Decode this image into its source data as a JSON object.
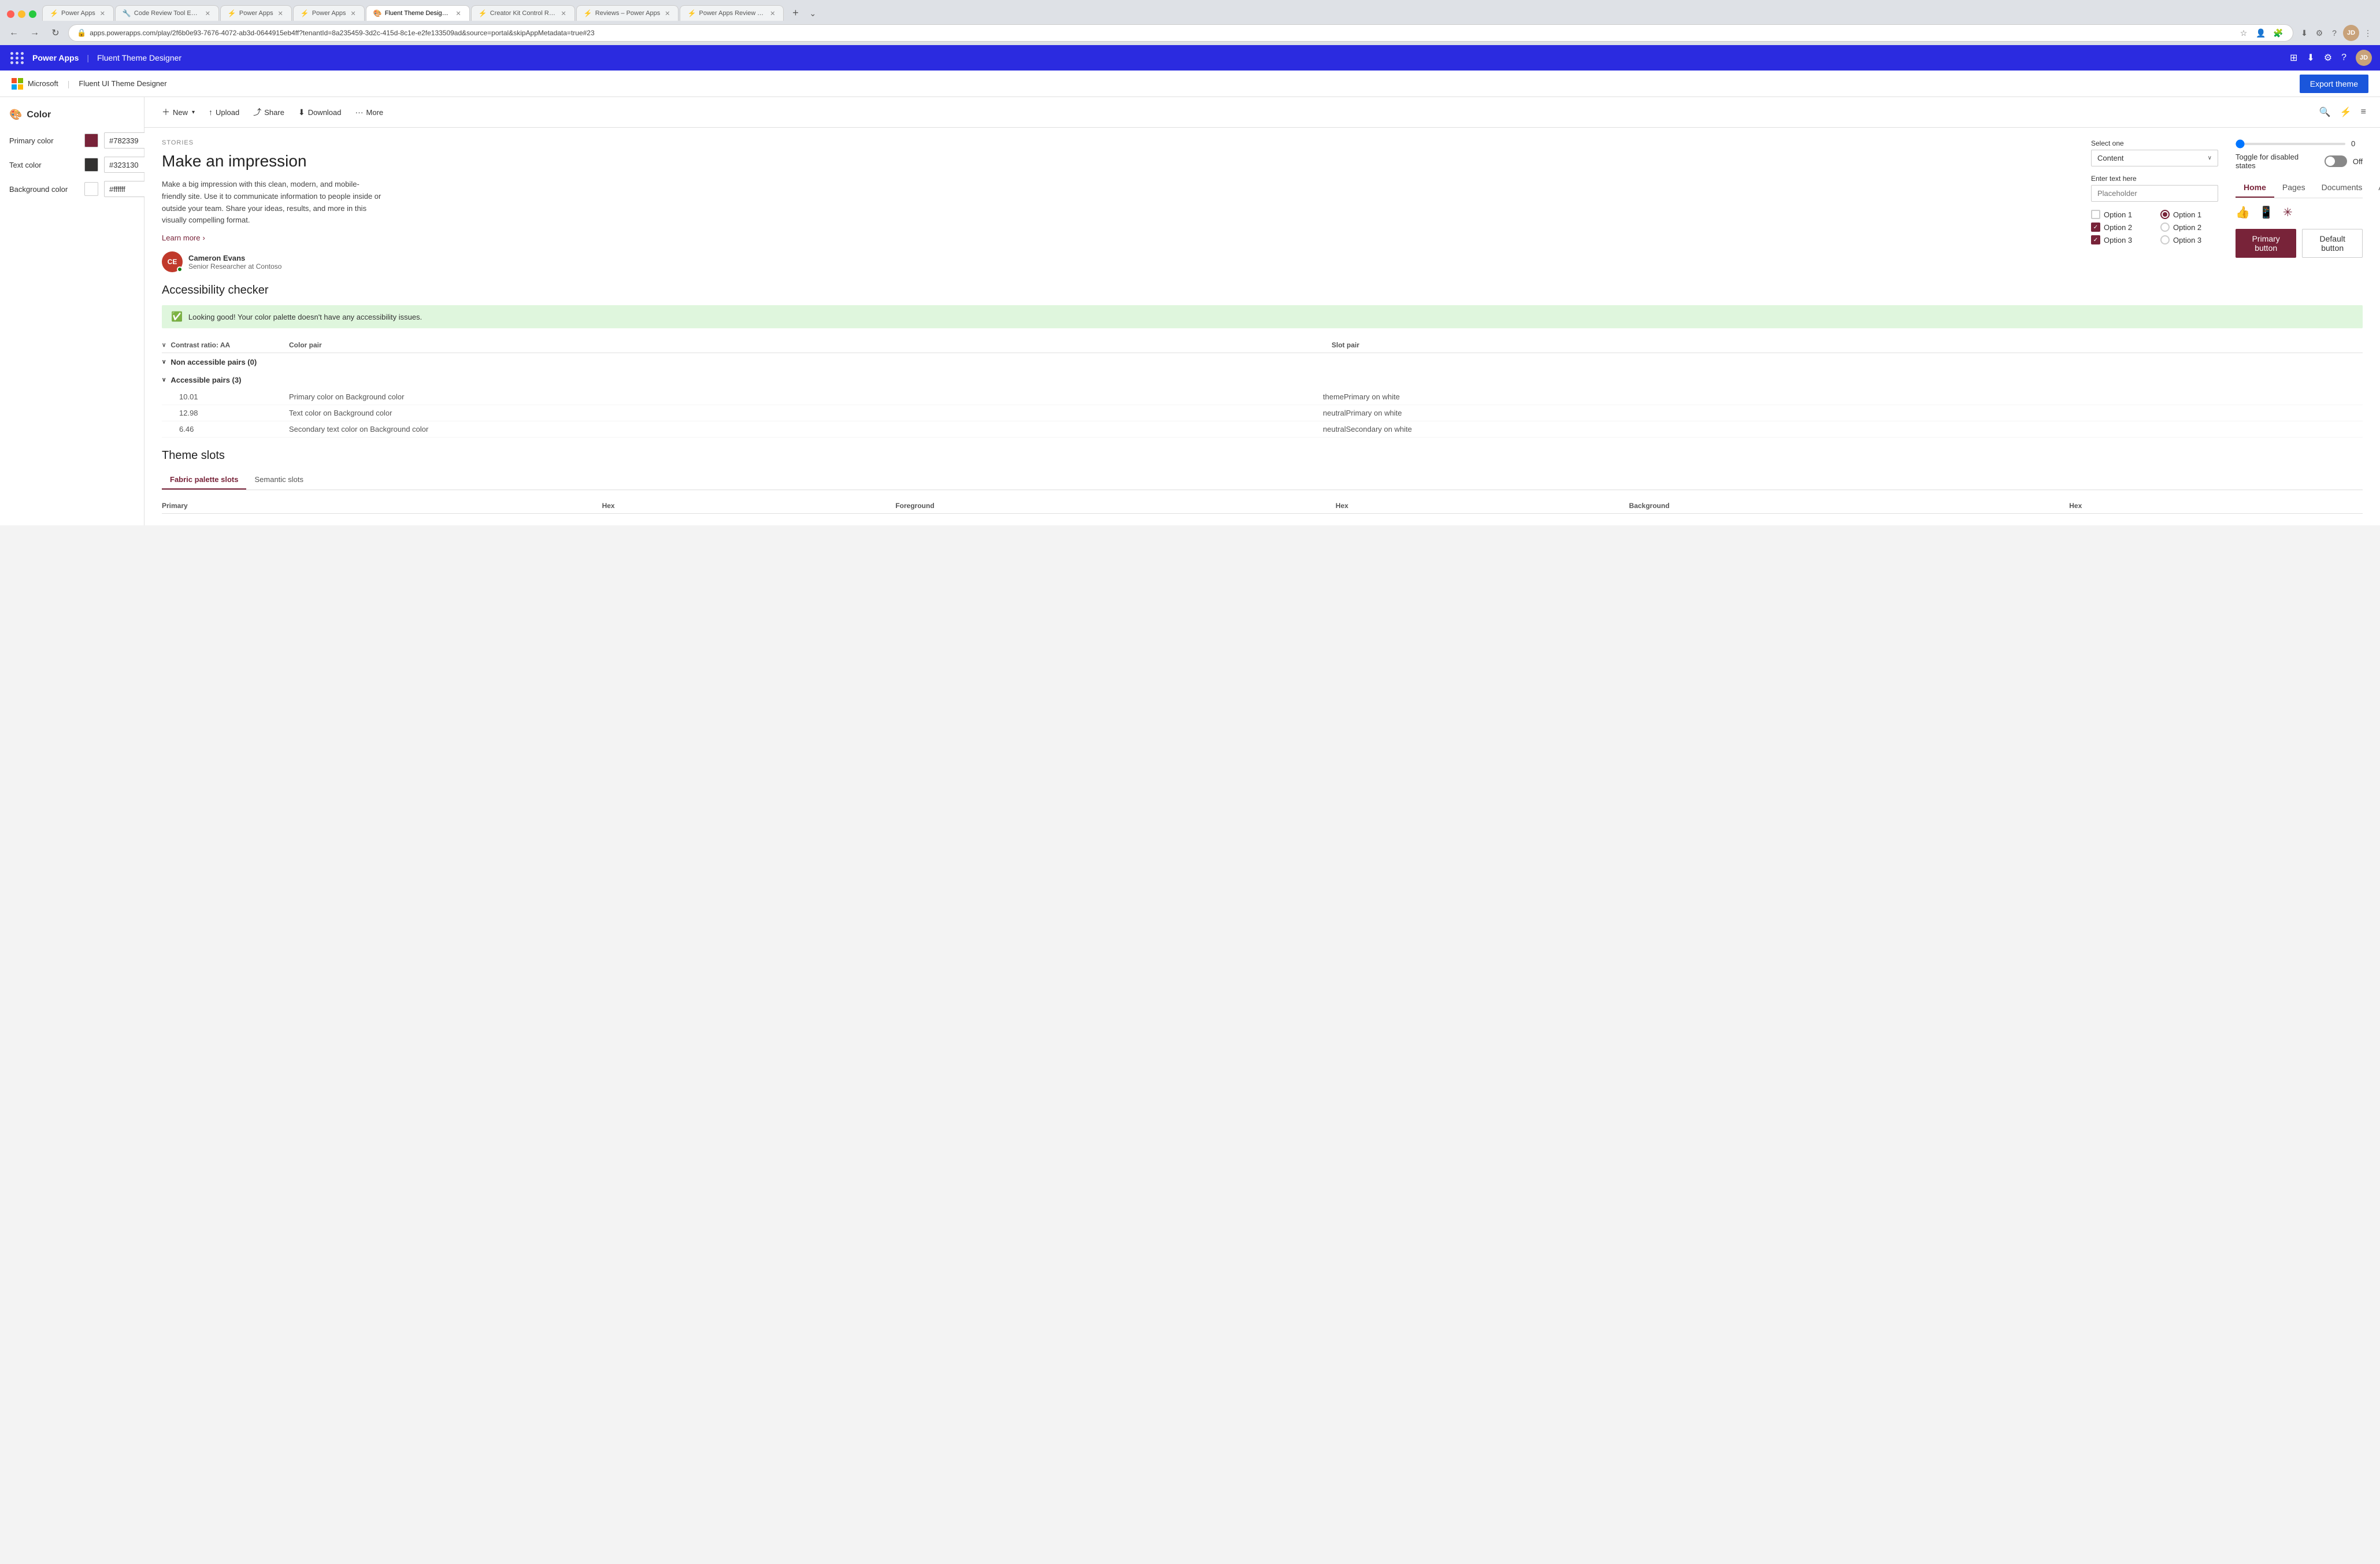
{
  "browser": {
    "tabs": [
      {
        "id": "t1",
        "favicon": "⚡",
        "title": "Power Apps",
        "active": false
      },
      {
        "id": "t2",
        "favicon": "🔧",
        "title": "Code Review Tool Experim...",
        "active": false
      },
      {
        "id": "t3",
        "favicon": "⚡",
        "title": "Power Apps",
        "active": false
      },
      {
        "id": "t4",
        "favicon": "⚡",
        "title": "Power Apps",
        "active": false
      },
      {
        "id": "t5",
        "favicon": "🎨",
        "title": "Fluent Theme Designer -",
        "active": true
      },
      {
        "id": "t6",
        "favicon": "⚡",
        "title": "Creator Kit Control Refere...",
        "active": false
      },
      {
        "id": "t7",
        "favicon": "⚡",
        "title": "Reviews – Power Apps",
        "active": false
      },
      {
        "id": "t8",
        "favicon": "⚡",
        "title": "Power Apps Review Tool ...",
        "active": false
      }
    ],
    "url": "apps.powerapps.com/play/2f6b0e93-7676-4072-ab3d-0644915eb4ff?tenantId=8a235459-3d2c-415d-8c1e-e2fe133509ad&source=portal&skipAppMetadata=true#23"
  },
  "appbar": {
    "brand": "Power Apps",
    "separator": "|",
    "page": "Fluent Theme Designer",
    "avatar_initials": "JD"
  },
  "logobar": {
    "brand": "Microsoft",
    "separator": "|",
    "tool_name": "Fluent UI Theme Designer",
    "export_btn": "Export theme"
  },
  "sidebar": {
    "title": "Color",
    "rows": [
      {
        "label": "Primary color",
        "color": "#782339",
        "value": "#782339"
      },
      {
        "label": "Text color",
        "color": "#323130",
        "value": "#323130"
      },
      {
        "label": "Background color",
        "color": "#ffffff",
        "value": "#ffffff"
      }
    ]
  },
  "toolbar": {
    "new_label": "New",
    "upload_label": "Upload",
    "share_label": "Share",
    "download_label": "Download",
    "more_label": "More"
  },
  "preview": {
    "stories_label": "STORIES",
    "headline": "Make an impression",
    "body": "Make a big impression with this clean, modern, and mobile-friendly site. Use it to communicate information to people inside or outside your team. Share your ideas, results, and more in this visually compelling format.",
    "learn_more": "Learn more",
    "author": {
      "initials": "CE",
      "name": "Cameron Evans",
      "title": "Senior Researcher at Contoso"
    },
    "dropdown": {
      "label": "Select one",
      "value": "Content"
    },
    "text_input": {
      "label": "Enter text here",
      "placeholder": "Placeholder"
    },
    "slider": {
      "value": "0"
    },
    "toggle": {
      "label": "Toggle for disabled states",
      "state": "Off"
    },
    "pivot_tabs": [
      {
        "label": "Home",
        "active": true
      },
      {
        "label": "Pages",
        "active": false
      },
      {
        "label": "Documents",
        "active": false
      },
      {
        "label": "Activity",
        "active": false
      }
    ],
    "checkboxes": [
      {
        "label": "Option 1",
        "checked": false
      },
      {
        "label": "Option 2",
        "checked": true
      },
      {
        "label": "Option 3",
        "checked": true
      }
    ],
    "radios": [
      {
        "label": "Option 1",
        "checked": true
      },
      {
        "label": "Option 2",
        "checked": false
      },
      {
        "label": "Option 3",
        "checked": false
      }
    ],
    "primary_button": "Primary button",
    "default_button": "Default button"
  },
  "accessibility": {
    "title": "Accessibility checker",
    "ok_message": "Looking good! Your color palette doesn't have any accessibility issues.",
    "table_headers": {
      "contrast": "Contrast ratio: AA",
      "color_pair": "Color pair",
      "slot_pair": "Slot pair"
    },
    "groups": [
      {
        "label": "Non accessible pairs (0)",
        "rows": []
      },
      {
        "label": "Accessible pairs (3)",
        "rows": [
          {
            "ratio": "10.01",
            "color_pair": "Primary color on Background color",
            "slot_pair": "themePrimary on white"
          },
          {
            "ratio": "12.98",
            "color_pair": "Text color on Background color",
            "slot_pair": "neutralPrimary on white"
          },
          {
            "ratio": "6.46",
            "color_pair": "Secondary text color on Background color",
            "slot_pair": "neutralSecondary on white"
          }
        ]
      }
    ]
  },
  "theme_slots": {
    "title": "Theme slots",
    "tabs": [
      {
        "label": "Fabric palette slots",
        "active": true
      },
      {
        "label": "Semantic slots",
        "active": false
      }
    ],
    "headers": {
      "primary": "Primary",
      "hex": "Hex",
      "foreground": "Foreground",
      "hex2": "Hex",
      "background": "Background",
      "hex3": "Hex"
    }
  }
}
